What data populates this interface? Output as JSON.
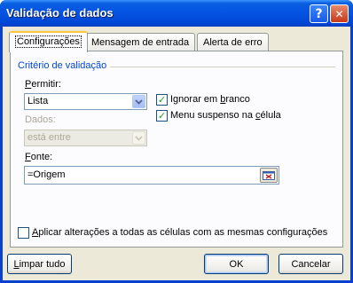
{
  "window": {
    "title": "Validação de dados",
    "help_glyph": "?",
    "close_glyph": "✕"
  },
  "tabs": [
    {
      "label": "Configurações",
      "active": true
    },
    {
      "label": "Mensagem de entrada",
      "active": false
    },
    {
      "label": "Alerta de erro",
      "active": false
    }
  ],
  "criteria": {
    "group_title": "Critério de validação",
    "allow_label_mnemonic": "P",
    "allow_label_rest": "ermitir:",
    "allow_value": "Lista",
    "data_label": "Dados:",
    "data_value": "está entre",
    "source_label_mnemonic": "F",
    "source_label_rest": "onte:",
    "source_value": "=Origem",
    "ignore_blank": {
      "pre": "Ignorar em ",
      "mnemonic": "b",
      "post": "ranco",
      "checked": true
    },
    "dropdown": {
      "pre": "Menu suspenso na ",
      "mnemonic": "c",
      "post": "élula",
      "checked": true
    }
  },
  "apply_all": {
    "mnemonic": "A",
    "rest": "plicar alterações a todas as células com as mesmas configurações",
    "checked": false
  },
  "buttons": {
    "clear_mnemonic": "L",
    "clear_rest": "impar tudo",
    "ok": "OK",
    "cancel": "Cancelar"
  },
  "colors": {
    "titlebar": "#0554e3",
    "accent": "#0046d5",
    "dialog_bg": "#ece9d8",
    "check": "#21a121",
    "tab_highlight": "#ffc83c"
  },
  "icons": {
    "dropdown_arrow": "chevron-down-icon",
    "range_picker": "collapse-dialog-icon"
  }
}
